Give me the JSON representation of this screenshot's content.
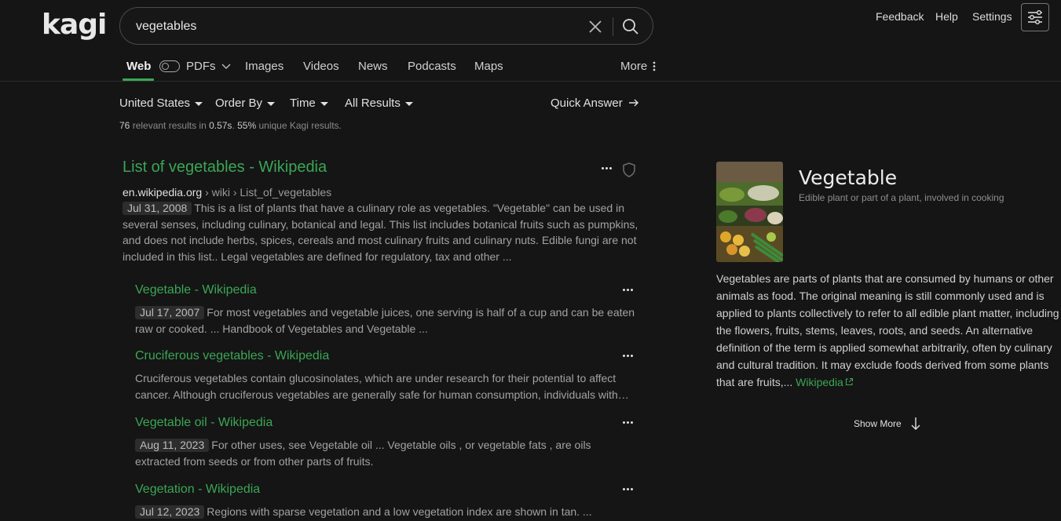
{
  "header": {
    "logo_text": "kagi",
    "search": {
      "value": "vegetables",
      "placeholder": ""
    },
    "links": {
      "feedback": "Feedback",
      "help": "Help",
      "settings": "Settings"
    }
  },
  "tabs": {
    "web": "Web",
    "pdfs": "PDFs",
    "images": "Images",
    "videos": "Videos",
    "news": "News",
    "podcasts": "Podcasts",
    "maps": "Maps",
    "more": "More"
  },
  "filters": {
    "region": "United States",
    "order": "Order By",
    "time": "Time",
    "results": "All Results",
    "quick_answer": "Quick Answer"
  },
  "stats": {
    "count": "76",
    "text1": " relevant results in ",
    "time": "0.57s",
    "text2": ". ",
    "unique": "55%",
    "text3": " unique Kagi results."
  },
  "main_result": {
    "title": "List of vegetables - Wikipedia",
    "domain": "en.wikipedia.org",
    "path": "› wiki › List_of_vegetables",
    "date": "Jul 31, 2008",
    "snippet": "This is a list of plants that have a culinary role as vegetables. \"Vegetable\" can be used in several senses, including culinary, botanical and legal. This list includes botanical fruits such as pumpkins, and does not include herbs, spices, cereals and most culinary fruits and culinary nuts. Edible fungi are not included in this list.. Legal vegetables are defined for regulatory, tax and other ..."
  },
  "sub_results": [
    {
      "title": "Vegetable - Wikipedia",
      "date": "Jul 17, 2007",
      "snippet": "For most vegetables and vegetable juices, one serving is half of a cup and can be eaten raw or cooked. ... Handbook of Vegetables and Vegetable ..."
    },
    {
      "title": "Cruciferous vegetables - Wikipedia",
      "date": "",
      "snippet": "Cruciferous vegetables contain glucosinolates, which are under research for their potential to affect cancer. Although cruciferous vegetables are generally safe for human consumption, individuals with…"
    },
    {
      "title": "Vegetable oil - Wikipedia",
      "date": "Aug 11, 2023",
      "snippet": "For other uses, see Vegetable oil ... Vegetable oils , or vegetable fats , are oils extracted from seeds or from other parts of fruits."
    },
    {
      "title": "Vegetation - Wikipedia",
      "date": "Jul 12, 2023",
      "snippet": "Regions with sparse vegetation and a low vegetation index are shown in tan. ..."
    }
  ],
  "knowledge_panel": {
    "title": "Vegetable",
    "subtitle": "Edible plant or part of a plant, involved in cooking",
    "description": "Vegetables are parts of plants that are consumed by humans or other animals as food. The original meaning is still commonly used and is applied to plants collectively to refer to all edible plant matter, including the flowers, fruits, stems, leaves, roots, and seeds. An alternative definition of the term is applied somewhat arbitrarily, often by culinary and cultural tradition. It may exclude foods derived from some plants that are fruits,...",
    "source": "Wikipedia",
    "show_more": "Show More"
  },
  "colors": {
    "accent": "#3aa655",
    "background": "#151515",
    "text": "#d8d8d8"
  }
}
